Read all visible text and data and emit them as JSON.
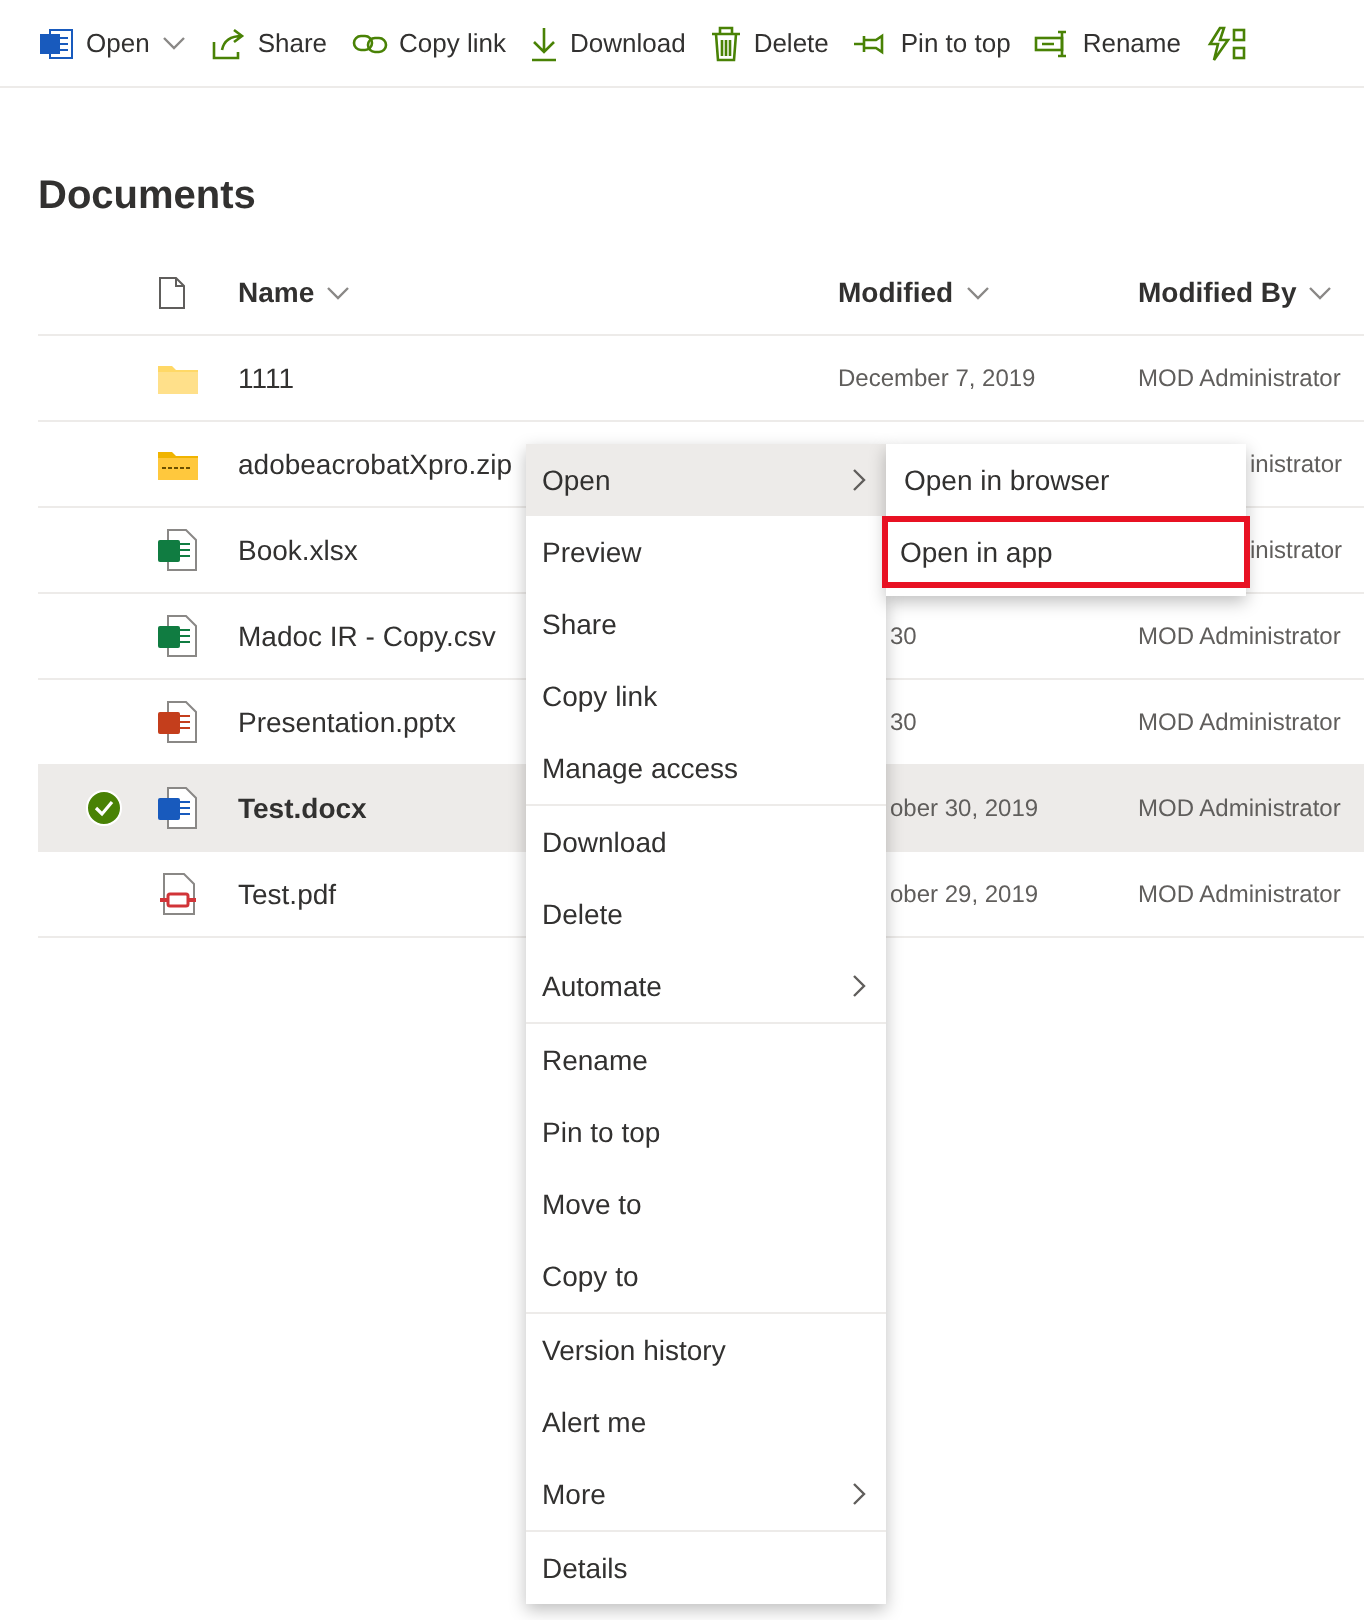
{
  "toolbar": [
    {
      "label": "Open",
      "kind": "word",
      "dropdown": true
    },
    {
      "label": "Share",
      "kind": "share",
      "dropdown": false
    },
    {
      "label": "Copy link",
      "kind": "link",
      "dropdown": false
    },
    {
      "label": "Download",
      "kind": "download",
      "dropdown": false
    },
    {
      "label": "Delete",
      "kind": "trash",
      "dropdown": false
    },
    {
      "label": "Pin to top",
      "kind": "pin",
      "dropdown": false
    },
    {
      "label": "Rename",
      "kind": "rename",
      "dropdown": false
    },
    {
      "kind": "flow",
      "dropdown": false
    }
  ],
  "title": "Documents",
  "columns": [
    {
      "label": "Name"
    },
    {
      "label": "Modified"
    },
    {
      "label": "Modified By"
    }
  ],
  "rows": [
    {
      "kind": "folder",
      "name": "1111",
      "modified": "December 7, 2019",
      "modified_by": "MOD Administrator",
      "selected": false
    },
    {
      "kind": "zip",
      "name": "adobeacrobatXpro.zip",
      "modified_by": "inistrator",
      "selected": false
    },
    {
      "kind": "excel",
      "name": "Book.xlsx",
      "modified_by": "inistrator",
      "selected": false
    },
    {
      "kind": "csv",
      "name": "Madoc IR - Copy.csv",
      "modified": "30",
      "modified_by": "MOD Administrator",
      "selected": false
    },
    {
      "kind": "powerpoint",
      "name": "Presentation.pptx",
      "modified": "30",
      "modified_by": "MOD Administrator",
      "selected": false
    },
    {
      "kind": "word",
      "name": "Test.docx",
      "modified": "ober 30, 2019",
      "modified_by": "MOD Administrator",
      "selected": true
    },
    {
      "kind": "pdf",
      "name": "Test.pdf",
      "modified": "ober 29, 2019",
      "modified_by": "MOD Administrator",
      "selected": false
    }
  ],
  "context_menu": [
    [
      {
        "label": "Open",
        "submenu": true,
        "selected": true
      },
      {
        "label": "Preview",
        "submenu": false,
        "selected": false
      },
      {
        "label": "Share",
        "submenu": false,
        "selected": false
      },
      {
        "label": "Copy link",
        "submenu": false,
        "selected": false
      },
      {
        "label": "Manage access",
        "submenu": false,
        "selected": false
      }
    ],
    [
      {
        "label": "Download",
        "submenu": false,
        "selected": false
      },
      {
        "label": "Delete",
        "submenu": false,
        "selected": false
      },
      {
        "label": "Automate",
        "submenu": true,
        "selected": false
      }
    ],
    [
      {
        "label": "Rename",
        "submenu": false,
        "selected": false
      },
      {
        "label": "Pin to top",
        "submenu": false,
        "selected": false
      },
      {
        "label": "Move to",
        "submenu": false,
        "selected": false
      },
      {
        "label": "Copy to",
        "submenu": false,
        "selected": false
      }
    ],
    [
      {
        "label": "Version history",
        "submenu": false,
        "selected": false
      },
      {
        "label": "Alert me",
        "submenu": false,
        "selected": false
      },
      {
        "label": "More",
        "submenu": true,
        "selected": false
      }
    ],
    [
      {
        "label": "Details",
        "submenu": false,
        "selected": false
      }
    ]
  ],
  "submenu": [
    {
      "label": "Open in browser",
      "outlined": false
    },
    {
      "label": "Open in app",
      "outlined": true
    }
  ]
}
